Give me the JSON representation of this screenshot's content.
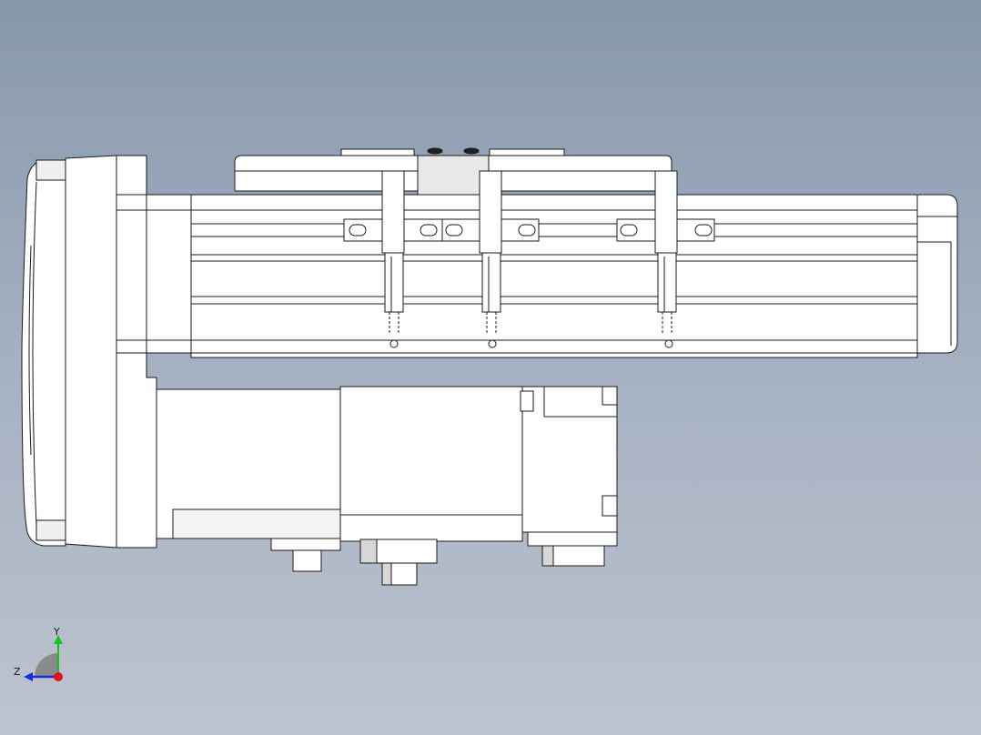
{
  "colors": {
    "background_top": "#8797ad",
    "background_bottom": "#bdc3cf",
    "part_fill": "#ffffff",
    "part_edge": "#1a1a1a",
    "shade": "#e6e6e6",
    "axis_y": "#17c21a",
    "axis_z": "#1730d6",
    "axis_x": "#e0141b"
  },
  "triad": {
    "y_label": "Y",
    "z_label": "Z"
  },
  "icons": {
    "triad": "coordinate-triad-icon"
  }
}
